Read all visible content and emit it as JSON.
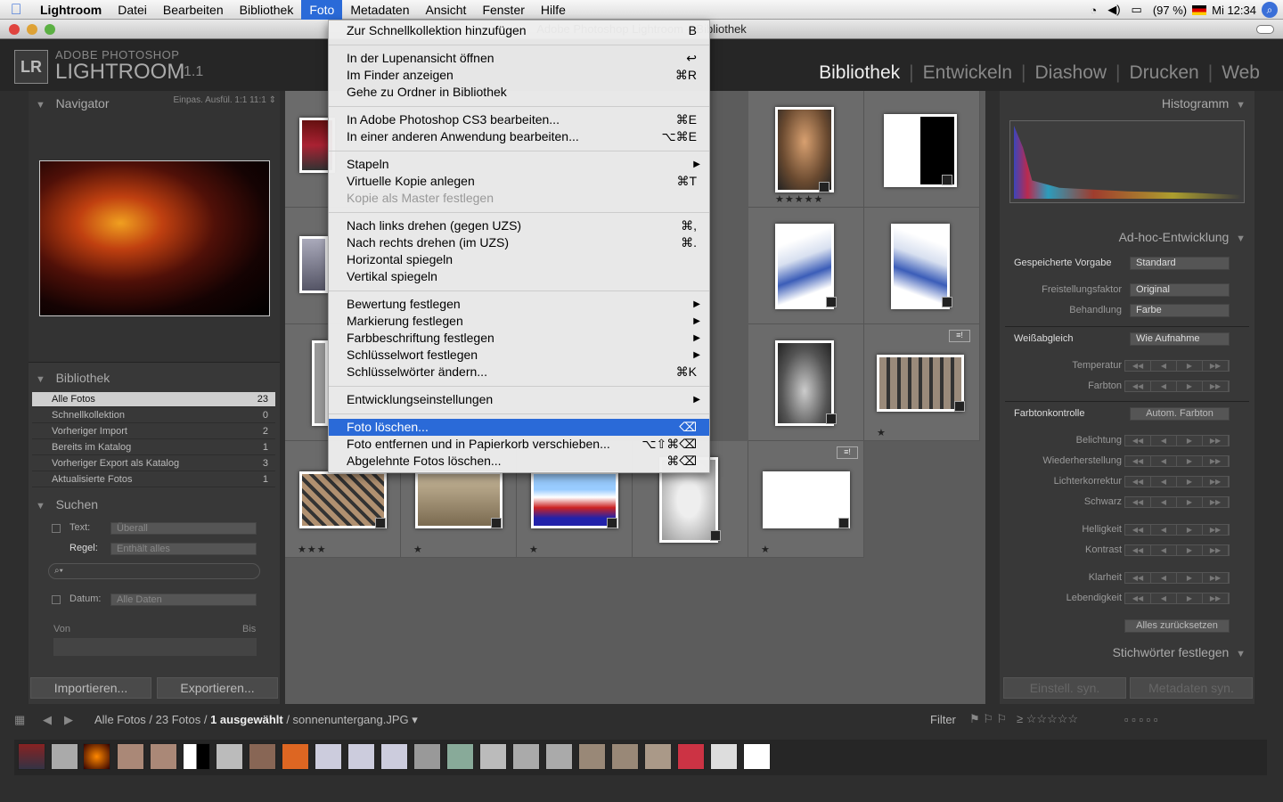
{
  "menubar": {
    "app": "Lightroom",
    "items": [
      "Datei",
      "Bearbeiten",
      "Bibliothek",
      "Foto",
      "Metadaten",
      "Ansicht",
      "Fenster",
      "Hilfe"
    ],
    "battery": "(97 %)",
    "clock": "Mi 12:34"
  },
  "window": {
    "title": "Adobe Photoshop Lightroom – Bibliothek"
  },
  "identity": {
    "logo": "LR",
    "line1": "ADOBE PHOTOSHOP",
    "line2": "LIGHTROOM",
    "version": "1.1"
  },
  "modules": [
    "Bibliothek",
    "Entwickeln",
    "Diashow",
    "Drucken",
    "Web"
  ],
  "navigator": {
    "title": "Navigator",
    "options": "Einpas.  Ausfül.  1:1  11:1 ⇕"
  },
  "library": {
    "title": "Bibliothek",
    "rows": [
      {
        "label": "Alle Fotos",
        "count": "23"
      },
      {
        "label": "Schnellkollektion",
        "count": "0"
      },
      {
        "label": "Vorheriger Import",
        "count": "2"
      },
      {
        "label": "Bereits im Katalog",
        "count": "1"
      },
      {
        "label": "Vorheriger Export als Katalog",
        "count": "3"
      },
      {
        "label": "Aktualisierte Fotos",
        "count": "1"
      }
    ]
  },
  "search": {
    "title": "Suchen",
    "text_label": "Text:",
    "text_value": "Überall",
    "rule_label": "Regel:",
    "rule_value": "Enthält alles",
    "date_label": "Datum:",
    "date_value": "Alle Daten",
    "from": "Von",
    "to": "Bis"
  },
  "left_buttons": {
    "import": "Importieren...",
    "export": "Exportieren..."
  },
  "menu": {
    "items": [
      {
        "label": "Zur Schnellkollektion hinzufügen",
        "shortcut": "B"
      },
      {
        "label": "In der Lupenansicht öffnen",
        "shortcut": "↩"
      },
      {
        "label": "Im Finder anzeigen",
        "shortcut": "⌘R"
      },
      {
        "label": "Gehe zu Ordner in Bibliothek",
        "shortcut": ""
      },
      {
        "label": "In Adobe Photoshop CS3 bearbeiten...",
        "shortcut": "⌘E"
      },
      {
        "label": "In einer anderen Anwendung bearbeiten...",
        "shortcut": "⌥⌘E"
      },
      {
        "label": "Stapeln",
        "shortcut": ""
      },
      {
        "label": "Virtuelle Kopie anlegen",
        "shortcut": "⌘T"
      },
      {
        "label": "Kopie als Master festlegen",
        "shortcut": ""
      },
      {
        "label": "Nach links drehen (gegen UZS)",
        "shortcut": "⌘,"
      },
      {
        "label": "Nach rechts drehen (im UZS)",
        "shortcut": "⌘."
      },
      {
        "label": "Horizontal spiegeln",
        "shortcut": ""
      },
      {
        "label": "Vertikal spiegeln",
        "shortcut": ""
      },
      {
        "label": "Bewertung festlegen",
        "shortcut": ""
      },
      {
        "label": "Markierung festlegen",
        "shortcut": ""
      },
      {
        "label": "Farbbeschriftung festlegen",
        "shortcut": ""
      },
      {
        "label": "Schlüsselwort festlegen",
        "shortcut": ""
      },
      {
        "label": "Schlüsselwörter ändern...",
        "shortcut": "⌘K"
      },
      {
        "label": "Entwicklungseinstellungen",
        "shortcut": ""
      },
      {
        "label": "Foto löschen...",
        "shortcut": "⌫"
      },
      {
        "label": "Foto entfernen und in Papierkorb verschieben...",
        "shortcut": "⌥⇧⌘⌫"
      },
      {
        "label": "Abgelehnte Fotos löschen...",
        "shortcut": "⌘⌫"
      }
    ]
  },
  "grid": {
    "stars": [
      "★★★★★",
      "★",
      "★★★",
      "★",
      "★",
      "★"
    ]
  },
  "right": {
    "histogram": "Histogramm",
    "quick_develop": "Ad-hoc-Entwicklung",
    "preset_label": "Gespeicherte Vorgabe",
    "preset_value": "Standard",
    "crop_label": "Freistellungsfaktor",
    "crop_value": "Original",
    "treatment_label": "Behandlung",
    "treatment_value": "Farbe",
    "wb_label": "Weißabgleich",
    "wb_value": "Wie Aufnahme",
    "temp_label": "Temperatur",
    "tint_label": "Farbton",
    "tone_label": "Farbtonkontrolle",
    "tone_auto": "Autom. Farbton",
    "exposure": "Belichtung",
    "recovery": "Wiederherstellung",
    "fill": "Lichterkorrektur",
    "blacks": "Schwarz",
    "brightness": "Helligkeit",
    "contrast": "Kontrast",
    "clarity": "Klarheit",
    "vibrance": "Lebendigkeit",
    "reset": "Alles zurücksetzen",
    "keywording": "Stichwörter festlegen",
    "sync_settings": "Einstell. syn.",
    "sync_meta": "Metadaten syn."
  },
  "filmstrip": {
    "path1": "Alle Fotos / 23 Fotos / ",
    "path2": "1 ausgewählt",
    "path3": " / sonnenuntergang.JPG",
    "filter": "Filter"
  }
}
